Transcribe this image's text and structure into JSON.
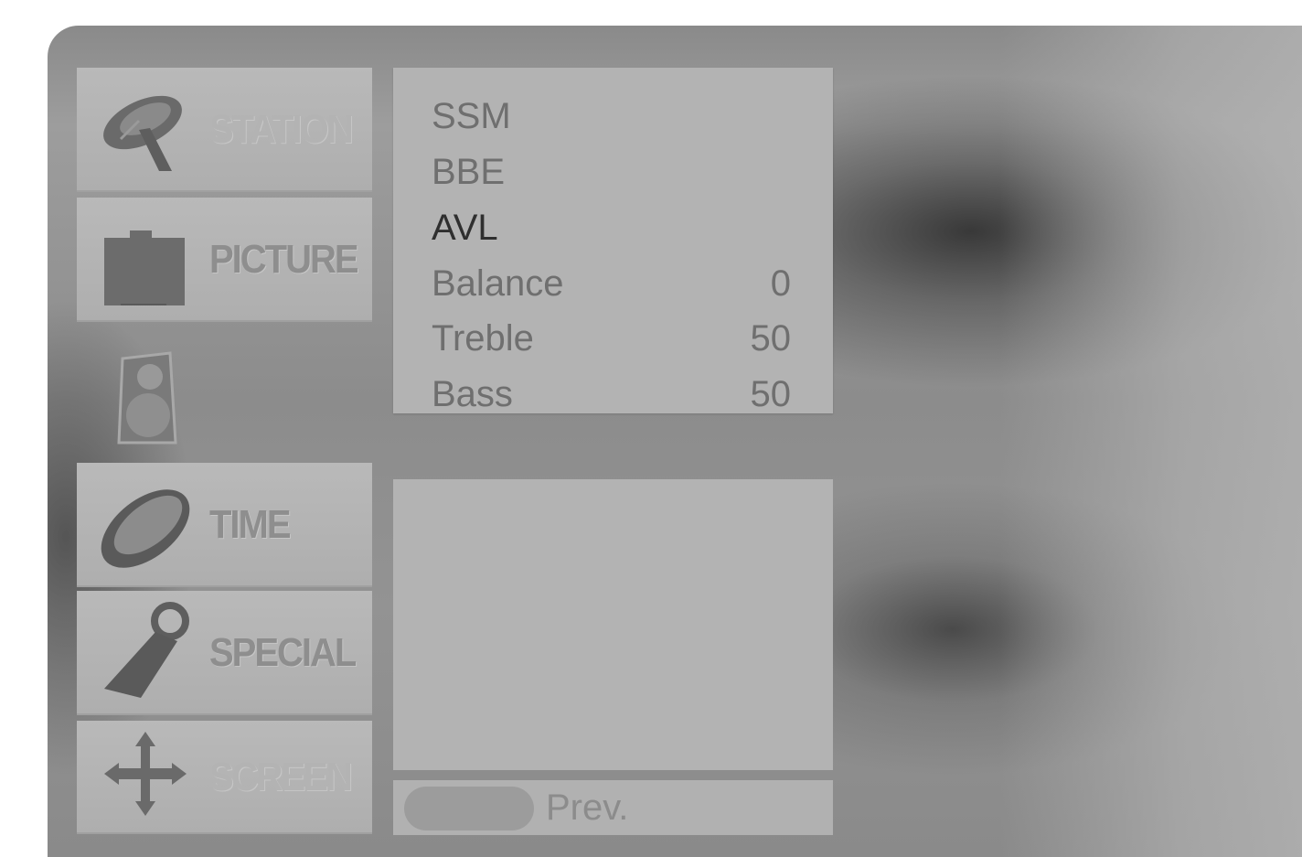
{
  "menu": {
    "items": [
      {
        "label": "STATION",
        "icon": "satellite-dish-icon"
      },
      {
        "label": "PICTURE",
        "icon": "picture-icon"
      },
      {
        "label": "",
        "icon": "speaker-icon",
        "selected": true
      },
      {
        "label": "TIME",
        "icon": "clock-icon"
      },
      {
        "label": "SPECIAL",
        "icon": "tag-icon"
      },
      {
        "label": "SCREEN",
        "icon": "move-arrows-icon"
      }
    ]
  },
  "submenu": {
    "rows": [
      {
        "name": "SSM",
        "value": ""
      },
      {
        "name": "BBE",
        "value": ""
      },
      {
        "name": "AVL",
        "value": ""
      },
      {
        "name": "Balance",
        "value": "0"
      },
      {
        "name": "Treble",
        "value": "50"
      },
      {
        "name": "Bass",
        "value": "50"
      }
    ]
  },
  "footer": {
    "prev_label": "Prev."
  }
}
